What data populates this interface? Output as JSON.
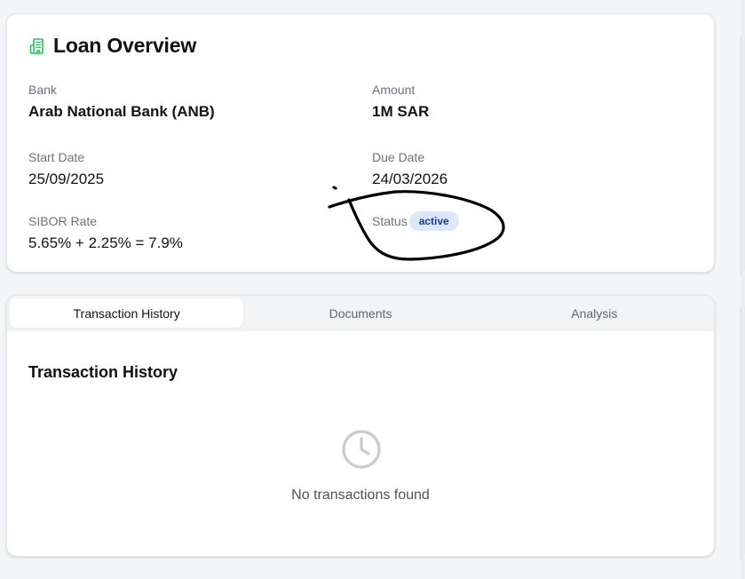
{
  "overview": {
    "title": "Loan Overview",
    "icon": "building-icon",
    "icon_color": "#22c55e",
    "bank": {
      "label": "Bank",
      "value": "Arab National Bank (ANB)"
    },
    "amount": {
      "label": "Amount",
      "value": "1M SAR"
    },
    "start_date": {
      "label": "Start Date",
      "value": "25/09/2025"
    },
    "due_date": {
      "label": "Due Date",
      "value": "24/03/2026"
    },
    "sibor": {
      "label": "SIBOR Rate",
      "value": "5.65% + 2.25% = 7.9%"
    },
    "status": {
      "label": "Status",
      "value": "active",
      "badge_bg": "#dbe8fc",
      "badge_color": "#1e3a8a"
    }
  },
  "tabs": [
    {
      "label": "Transaction History",
      "active": true
    },
    {
      "label": "Documents",
      "active": false
    },
    {
      "label": "Analysis",
      "active": false
    }
  ],
  "history": {
    "title": "Transaction History",
    "empty_icon": "clock-icon",
    "empty_text": "No transactions found"
  },
  "annotation": {
    "type": "hand-drawn-circle",
    "color": "#000000"
  }
}
